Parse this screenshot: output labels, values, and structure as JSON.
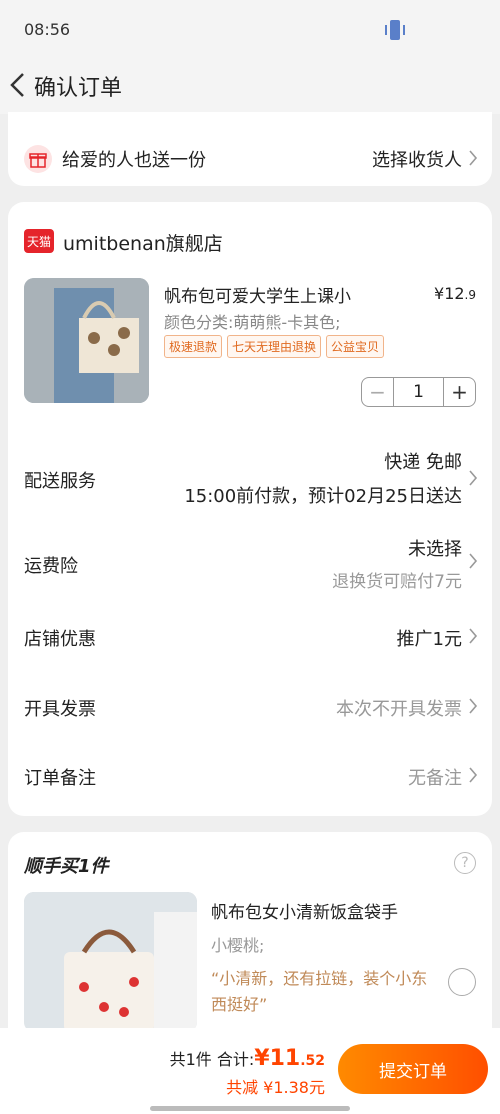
{
  "status_bar": {
    "time": "08:56"
  },
  "header": {
    "title": "确认订单"
  },
  "gift": {
    "label": "给爱的人也送一份",
    "action": "选择收货人"
  },
  "shop": {
    "logo_text": "天猫",
    "name": "umitbenan旗舰店",
    "product": {
      "title": "帆布包可爱大学生上课小",
      "price_symbol": "¥",
      "price_int": "12",
      "price_dec": ".9",
      "sku": "颜色分类:萌萌熊-卡其色;",
      "tags": [
        "极速退款",
        "七天无理由退换",
        "公益宝贝"
      ],
      "quantity": "1",
      "minus": "−",
      "plus": "+"
    }
  },
  "rows": {
    "delivery": {
      "label": "配送服务",
      "value": "快递 免邮",
      "sub": "15:00前付款，预计02月25日送达"
    },
    "insurance": {
      "label": "运费险",
      "value": "未选择",
      "sub": "退换货可赔付7元"
    },
    "discount": {
      "label": "店铺优惠",
      "value": "推广1元"
    },
    "invoice": {
      "label": "开具发票",
      "value": "本次不开具发票"
    },
    "note": {
      "label": "订单备注",
      "value": "无备注"
    }
  },
  "addon": {
    "title": "顺手买1件",
    "help": "?",
    "name": "帆布包女小清新饭盒袋手",
    "sku": "小樱桃;",
    "quote": "“小清新，还有拉链，装个小东西挺好”"
  },
  "footer": {
    "count": "共1件",
    "total_label": "合计:",
    "total_symbol": "¥",
    "total_int": "11",
    "total_dec": ".52",
    "discount": "共减 ¥1.38元",
    "submit": "提交订单"
  }
}
